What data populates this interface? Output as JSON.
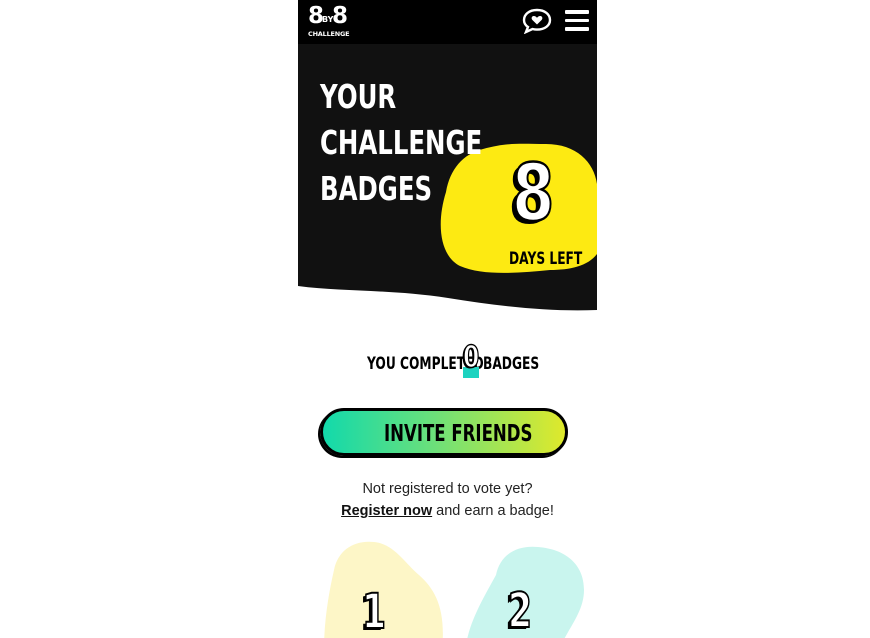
{
  "header": {
    "logo_left": "8",
    "logo_by": "BY",
    "logo_right": "8",
    "logo_sub": "CHALLENGE",
    "chat_icon": "speech-bubble-heart-icon",
    "menu_icon": "hamburger-menu-icon"
  },
  "hero": {
    "title_line1": "YOUR",
    "title_line2": "CHALLENGE",
    "title_line3": "BADGES",
    "days_left_value": "8",
    "days_left_label": "DAYS LEFT"
  },
  "progress": {
    "prefix": "YOU COMPLETED",
    "count": "0",
    "suffix": "BADGES"
  },
  "invite": {
    "label": "INVITE FRIENDS"
  },
  "register": {
    "line1": "Not registered to vote yet?",
    "link_text": "Register now",
    "line2_rest": " and earn a badge!"
  },
  "badges": [
    {
      "number": "1",
      "color": "#fdf6c7"
    },
    {
      "number": "2",
      "color": "#c9f5ee"
    }
  ],
  "colors": {
    "bar_bg": "#000000",
    "hero_bg": "#111111",
    "accent_yellow": "#fdea12",
    "accent_teal": "#1dd3c0"
  }
}
